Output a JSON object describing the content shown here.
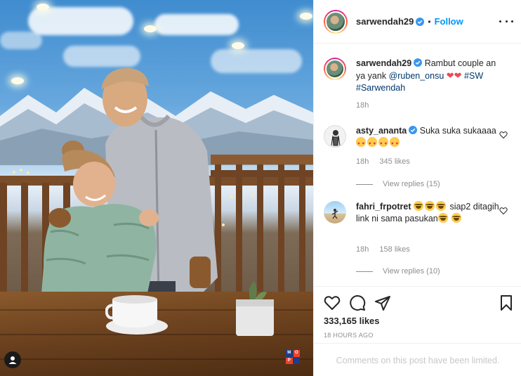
{
  "post": {
    "username": "sarwendah29",
    "follow_label": "Follow",
    "dot": "•"
  },
  "caption": {
    "username": "sarwendah29",
    "text_before": "Rambut couple an ya yank ",
    "mention": "@ruben_onsu",
    "hearts": "❤❤",
    "tag1": "#SW",
    "tag2": "#Sarwendah",
    "age": "18h"
  },
  "comments": [
    {
      "username": "asty_ananta",
      "text": "Suka suka sukaaaa",
      "emoji": "heart-eyes x4",
      "age": "18h",
      "likes": "345 likes",
      "view_replies": "View replies (15)"
    },
    {
      "username": "fahri_frpotret",
      "text_mid": "siap2 ditagih link ni sama pasukan",
      "emoji": "tears-of-joy x5",
      "age": "18h",
      "likes": "158 likes",
      "view_replies": "View replies (10)"
    }
  ],
  "actions": {
    "likes": "333,165 likes",
    "time": "18 HOURS AGO",
    "limited": "Comments on this post have been limited."
  },
  "badge": {
    "letters": [
      "M",
      "O",
      "P",
      ""
    ]
  },
  "icons": {
    "verified": "verified-badge-icon",
    "more": "more-options-icon",
    "like": "heart-icon",
    "comment": "comment-icon",
    "share": "paper-plane-icon",
    "save": "bookmark-icon"
  },
  "colors": {
    "accent": "#0095f6",
    "muted": "#8e8e8e",
    "text": "#262626",
    "mention": "#00376b"
  }
}
